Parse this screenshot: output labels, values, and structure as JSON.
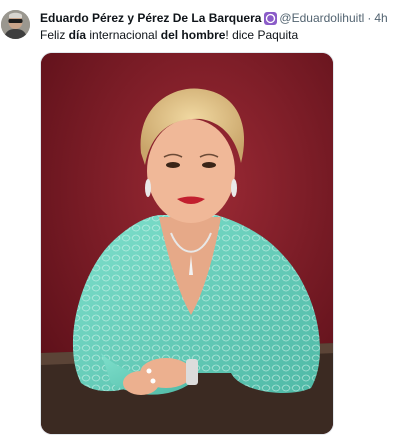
{
  "tweet": {
    "author": {
      "display_name": "Eduardo Pérez y Pérez De La Barquera",
      "handle": "@Eduardolihuitl",
      "separator": "·",
      "timestamp": "4h",
      "badge_icon": "verified-badge-icon",
      "badge_color": "#8b5cc8"
    },
    "text": {
      "part1": "Feliz ",
      "bold1": "día",
      "part2": " internacional ",
      "bold2": "del hombre",
      "part3": "! dice Paquita"
    },
    "media": {
      "type": "photo",
      "description_icon": "photo-icon"
    }
  },
  "colors": {
    "text_primary": "#0f1419",
    "text_secondary": "#536471",
    "photo_background": "#7a1a24",
    "dress": "#6fd3c0"
  }
}
